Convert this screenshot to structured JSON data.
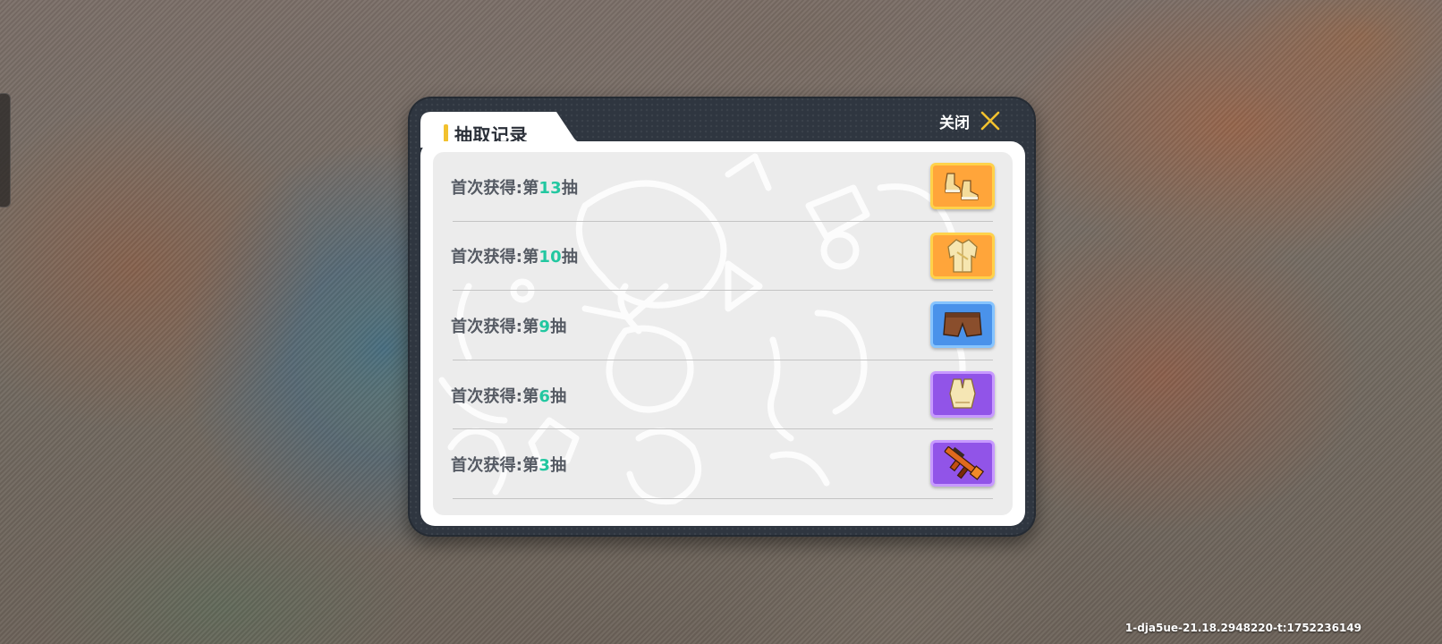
{
  "dialog": {
    "title": "抽取记录",
    "close_label": "关闭"
  },
  "records": [
    {
      "prefix": "首次获得:第",
      "number": "13",
      "suffix": "抽",
      "item_icon": "shoes-icon",
      "rarity": "orange",
      "rarity_color": "#ffa53a"
    },
    {
      "prefix": "首次获得:第",
      "number": "10",
      "suffix": "抽",
      "item_icon": "jacket-icon",
      "rarity": "orange",
      "rarity_color": "#ffa53a"
    },
    {
      "prefix": "首次获得:第",
      "number": "9",
      "suffix": "抽",
      "item_icon": "shorts-icon",
      "rarity": "blue",
      "rarity_color": "#4a92ea"
    },
    {
      "prefix": "首次获得:第",
      "number": "6",
      "suffix": "抽",
      "item_icon": "gloves-icon",
      "rarity": "purple",
      "rarity_color": "#9154e8"
    },
    {
      "prefix": "首次获得:第",
      "number": "3",
      "suffix": "抽",
      "item_icon": "rifle-icon",
      "rarity": "purple",
      "rarity_color": "#9154e8"
    }
  ],
  "footer": {
    "build_id": "1-dja5ue-21.18.2948220-t:1752236149"
  },
  "colors": {
    "accent_yellow": "#f2c12e",
    "number_green": "#22c7a0",
    "dialog_dark": "#2f3640"
  }
}
